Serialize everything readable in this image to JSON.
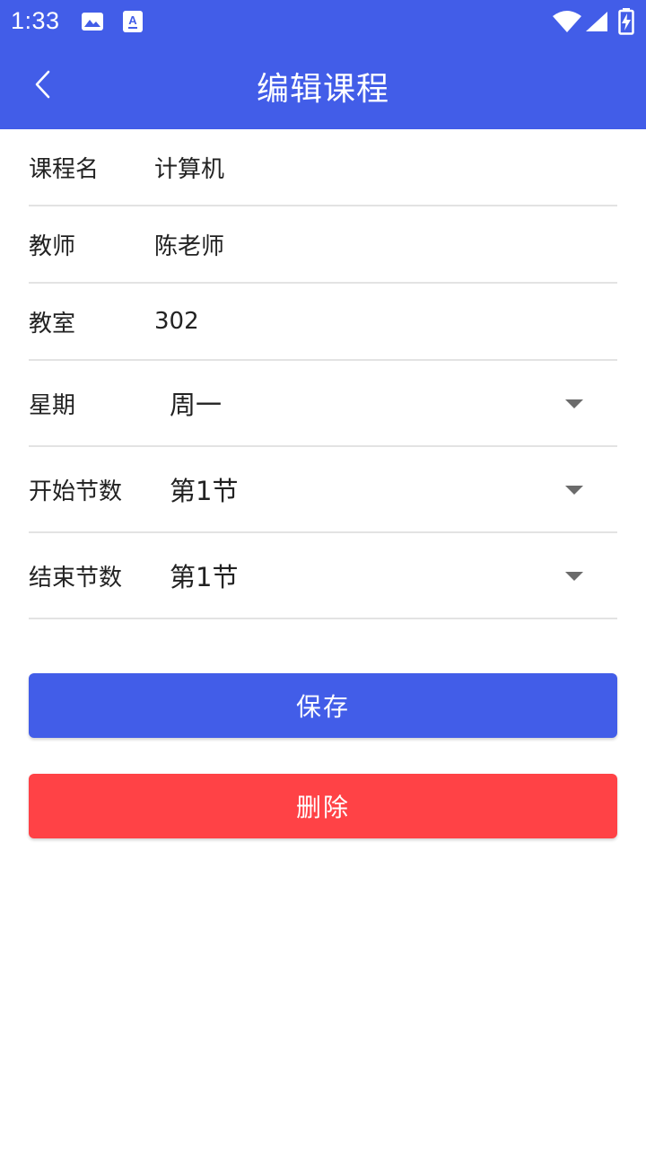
{
  "status_bar": {
    "time": "1:33",
    "icons": [
      "image-icon",
      "accessibility-text-icon",
      "wifi-icon",
      "signal-icon",
      "battery-charging-icon"
    ]
  },
  "header": {
    "title": "编辑课程",
    "back_icon": "chevron-left-icon"
  },
  "form": {
    "course_name": {
      "label": "课程名",
      "value": "计算机"
    },
    "teacher": {
      "label": "教师",
      "value": "陈老师"
    },
    "classroom": {
      "label": "教室",
      "value": "302"
    },
    "weekday": {
      "label": "星期",
      "value": "周一"
    },
    "start_section": {
      "label": "开始节数",
      "value": "第1节"
    },
    "end_section": {
      "label": "结束节数",
      "value": "第1节"
    }
  },
  "actions": {
    "save_label": "保存",
    "delete_label": "删除"
  },
  "colors": {
    "primary": "#425de8",
    "danger": "#ff4246",
    "divider": "#e3e3e3"
  }
}
